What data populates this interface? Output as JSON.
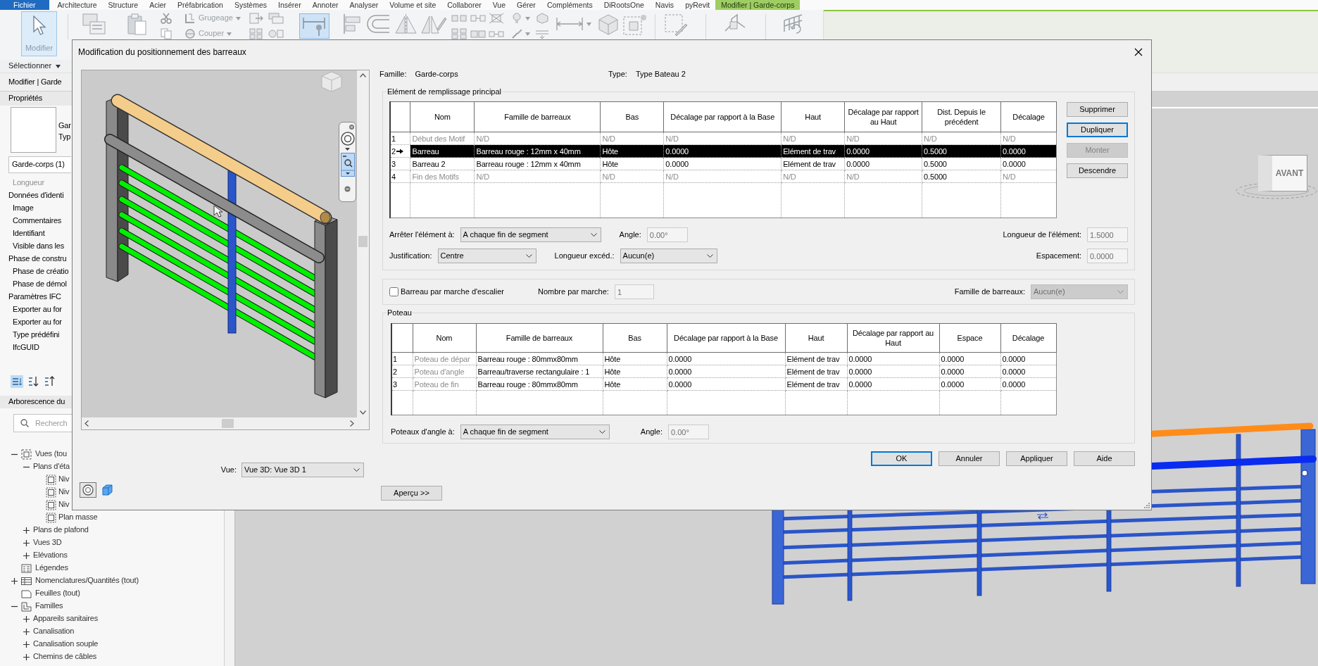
{
  "ribbon_tabs": [
    {
      "label": "Fichier",
      "kind": "file",
      "selected": false
    },
    {
      "label": "Architecture",
      "kind": "standard",
      "selected": false
    },
    {
      "label": "Structure",
      "kind": "standard",
      "selected": false
    },
    {
      "label": "Acier",
      "kind": "standard",
      "selected": false
    },
    {
      "label": "Préfabrication",
      "kind": "standard",
      "selected": false
    },
    {
      "label": "Systèmes",
      "kind": "standard",
      "selected": false
    },
    {
      "label": "Insérer",
      "kind": "standard",
      "selected": false
    },
    {
      "label": "Annoter",
      "kind": "standard",
      "selected": false
    },
    {
      "label": "Analyser",
      "kind": "standard",
      "selected": false
    },
    {
      "label": "Volume et site",
      "kind": "standard",
      "selected": false
    },
    {
      "label": "Collaborer",
      "kind": "standard",
      "selected": false
    },
    {
      "label": "Vue",
      "kind": "standard",
      "selected": false
    },
    {
      "label": "Gérer",
      "kind": "standard",
      "selected": false
    },
    {
      "label": "Compléments",
      "kind": "standard",
      "selected": false
    },
    {
      "label": "DiRootsOne",
      "kind": "standard",
      "selected": false
    },
    {
      "label": "Navis",
      "kind": "standard",
      "selected": false
    },
    {
      "label": "pyRevit",
      "kind": "standard",
      "selected": false
    },
    {
      "label": "Modifier | Garde-corps",
      "kind": "contextual",
      "selected": true
    }
  ],
  "ribbon": {
    "modify_button": {
      "label": "Modifier",
      "selected": true
    },
    "small_tools": [
      {
        "label": "Grugeage"
      },
      {
        "label": "Couper"
      }
    ],
    "select_menu": "Sélectionner"
  },
  "options_bar": {
    "context": "Modifier | Garde"
  },
  "properties": {
    "title": "Propriétés",
    "type_lines": [
      "Gar",
      "Typ"
    ],
    "instance_selector": "Garde-corps (1)",
    "rows": [
      {
        "label": "Longueur",
        "kind": "parameter",
        "disabled": true
      },
      {
        "label": "Données d'identi",
        "kind": "group",
        "disabled": false
      },
      {
        "label": "Image",
        "kind": "parameter",
        "disabled": false
      },
      {
        "label": "Commentaires",
        "kind": "parameter",
        "disabled": false
      },
      {
        "label": "Identifiant",
        "kind": "parameter",
        "disabled": false
      },
      {
        "label": "Visible dans les",
        "kind": "parameter",
        "disabled": false
      },
      {
        "label": "Phase de constru",
        "kind": "group",
        "disabled": false
      },
      {
        "label": "Phase de créatio",
        "kind": "parameter",
        "disabled": false
      },
      {
        "label": "Phase de démol",
        "kind": "parameter",
        "disabled": false
      },
      {
        "label": "Paramètres IFC",
        "kind": "group",
        "disabled": false
      },
      {
        "label": "Exporter au for",
        "kind": "parameter",
        "disabled": false
      },
      {
        "label": "Exporter au for",
        "kind": "parameter",
        "disabled": false
      },
      {
        "label": "Type prédéfini",
        "kind": "parameter",
        "disabled": false
      },
      {
        "label": "IfcGUID",
        "kind": "parameter",
        "disabled": false
      }
    ],
    "sort_buttons": [
      {
        "kind": "categorized",
        "selected": true
      },
      {
        "kind": "ascending",
        "selected": false
      },
      {
        "kind": "descending",
        "selected": false
      }
    ]
  },
  "project_browser": {
    "title": "Arborescence du",
    "search": {
      "placeholder": "Recherch"
    },
    "tree": [
      {
        "label": "Vues (tou",
        "kind": "views",
        "expanded": true,
        "children": [
          {
            "label": "Plans d'éta",
            "expanded": true,
            "children": [
              {
                "label": "Niv",
                "kind": "plan"
              },
              {
                "label": "Niv",
                "kind": "plan"
              },
              {
                "label": "Niv",
                "kind": "plan"
              },
              {
                "label": "Plan masse",
                "kind": "plan"
              }
            ]
          },
          {
            "label": "Plans de plafond",
            "expanded": false
          },
          {
            "label": "Vues 3D",
            "expanded": false
          },
          {
            "label": "Elévations",
            "expanded": false
          }
        ]
      },
      {
        "label": "Légendes",
        "kind": "legend"
      },
      {
        "label": "Nomenclatures/Quantités (tout)",
        "kind": "schedule",
        "expanded": false
      },
      {
        "label": "Feuilles (tout)",
        "kind": "sheet"
      },
      {
        "label": "Familles",
        "kind": "family",
        "expanded": true,
        "children": [
          {
            "label": "Appareils sanitaires",
            "expanded": false
          },
          {
            "label": "Canalisation",
            "expanded": false
          },
          {
            "label": "Canalisation souple",
            "expanded": false
          },
          {
            "label": "Chemins de câbles",
            "expanded": false
          }
        ]
      }
    ]
  },
  "view": {
    "view_cube_label": "AVANT"
  },
  "dialog": {
    "title": "Modification du positionnement des barreaux",
    "preview": {
      "view_label": "Vue:",
      "view_select": "Vue 3D: Vue 3D 1"
    },
    "family": {
      "label": "Famille:",
      "value": "Garde-corps"
    },
    "type": {
      "label": "Type:",
      "value": "Type Bateau 2"
    },
    "main_pattern": {
      "title": "Elément de remplissage principal",
      "columns": [
        "Nom",
        "Famille de barreaux",
        "Bas",
        "Décalage par rapport à la Base",
        "Haut",
        "Décalage par rapport au Haut",
        "Dist. Depuis le précédent",
        "Décalage"
      ],
      "rows": [
        {
          "number": "1",
          "selected": false,
          "cells": [
            {
              "text": "Début des Motif",
              "disabled": true
            },
            {
              "text": "N/D",
              "disabled": true
            },
            {
              "text": "N/D",
              "disabled": true
            },
            {
              "text": "N/D",
              "disabled": true
            },
            {
              "text": "N/D",
              "disabled": true
            },
            {
              "text": "N/D",
              "disabled": true
            },
            {
              "text": "N/D",
              "disabled": true
            },
            {
              "text": "N/D",
              "disabled": true
            }
          ]
        },
        {
          "number": "2",
          "selected": true,
          "cells": [
            {
              "text": "Barreau",
              "disabled": false
            },
            {
              "text": "Barreau rouge : 12mm x 40mm",
              "disabled": false
            },
            {
              "text": "Hôte",
              "disabled": false
            },
            {
              "text": "0.0000",
              "disabled": false
            },
            {
              "text": "Elément de trav",
              "disabled": false
            },
            {
              "text": "0.0000",
              "disabled": false
            },
            {
              "text": "0.5000",
              "disabled": false
            },
            {
              "text": "0.0000",
              "disabled": false
            }
          ]
        },
        {
          "number": "3",
          "selected": false,
          "cells": [
            {
              "text": "Barreau 2",
              "disabled": false
            },
            {
              "text": "Barreau rouge : 12mm x 40mm",
              "disabled": false
            },
            {
              "text": "Hôte",
              "disabled": false
            },
            {
              "text": "0.0000",
              "disabled": false
            },
            {
              "text": "Elément de trav",
              "disabled": false
            },
            {
              "text": "0.0000",
              "disabled": false
            },
            {
              "text": "0.5000",
              "disabled": false
            },
            {
              "text": "0.0000",
              "disabled": false
            }
          ]
        },
        {
          "number": "4",
          "selected": false,
          "cells": [
            {
              "text": "Fin des Motifs",
              "disabled": true
            },
            {
              "text": "N/D",
              "disabled": true
            },
            {
              "text": "N/D",
              "disabled": true
            },
            {
              "text": "N/D",
              "disabled": true
            },
            {
              "text": "N/D",
              "disabled": true
            },
            {
              "text": "N/D",
              "disabled": true
            },
            {
              "text": "0.5000",
              "disabled": false
            },
            {
              "text": "N/D",
              "disabled": true
            }
          ]
        }
      ],
      "buttons": [
        {
          "label": "Supprimer",
          "disabled": false,
          "focused": false
        },
        {
          "label": "Dupliquer",
          "disabled": false,
          "focused": true
        },
        {
          "label": "Monter",
          "disabled": true,
          "focused": false
        },
        {
          "label": "Descendre",
          "disabled": false,
          "focused": false
        }
      ],
      "field_rows": [
        [
          {
            "label": "Arrêter l'élément à:",
            "kind": "select",
            "value": "A chaque fin de segment",
            "disabled": false
          },
          {
            "label": "Angle:",
            "kind": "input",
            "value": "0.00°",
            "disabled": true
          },
          {
            "label": "Longueur de l'élément:",
            "kind": "input",
            "value": "1.5000",
            "disabled": true
          }
        ],
        [
          {
            "label": "Justification:",
            "kind": "select",
            "value": "Centre",
            "disabled": false
          },
          {
            "label": "Longueur excéd.:",
            "kind": "select",
            "value": "Aucun(e)",
            "disabled": false
          },
          {
            "label": "Espacement:",
            "kind": "input",
            "value": "0.0000",
            "disabled": true
          }
        ]
      ]
    },
    "stair": {
      "checkbox": {
        "label": "Barreau par marche d'escalier",
        "checked": false
      },
      "fields": [
        {
          "label": "Nombre par marche:",
          "kind": "input",
          "value": "1",
          "disabled": true
        },
        {
          "label": "Famille de barreaux:",
          "kind": "select",
          "value": "Aucun(e)",
          "disabled": true
        }
      ]
    },
    "posts": {
      "title": "Poteau",
      "columns": [
        "Nom",
        "Famille de barreaux",
        "Bas",
        "Décalage par rapport à la Base",
        "Haut",
        "Décalage par rapport au Haut",
        "Espace",
        "Décalage"
      ],
      "rows": [
        {
          "number": "1",
          "selected": false,
          "cells": [
            {
              "text": "Poteau de dépar",
              "disabled": true
            },
            {
              "text": "Barreau rouge : 80mmx80mm",
              "disabled": false
            },
            {
              "text": "Hôte",
              "disabled": false
            },
            {
              "text": "0.0000",
              "disabled": false
            },
            {
              "text": "Elément de trav",
              "disabled": false
            },
            {
              "text": "0.0000",
              "disabled": false
            },
            {
              "text": "0.0000",
              "disabled": false
            },
            {
              "text": "0.0000",
              "disabled": false
            }
          ]
        },
        {
          "number": "2",
          "selected": false,
          "cells": [
            {
              "text": "Poteau d'angle",
              "disabled": true
            },
            {
              "text": "Barreau/traverse rectangulaire : 1",
              "disabled": false
            },
            {
              "text": "Hôte",
              "disabled": false
            },
            {
              "text": "0.0000",
              "disabled": false
            },
            {
              "text": "Elément de trav",
              "disabled": false
            },
            {
              "text": "0.0000",
              "disabled": false
            },
            {
              "text": "0.0000",
              "disabled": false
            },
            {
              "text": "0.0000",
              "disabled": false
            }
          ]
        },
        {
          "number": "3",
          "selected": false,
          "cells": [
            {
              "text": "Poteau de fin",
              "disabled": true
            },
            {
              "text": "Barreau rouge : 80mmx80mm",
              "disabled": false
            },
            {
              "text": "Hôte",
              "disabled": false
            },
            {
              "text": "0.0000",
              "disabled": false
            },
            {
              "text": "Elément de trav",
              "disabled": false
            },
            {
              "text": "0.0000",
              "disabled": false
            },
            {
              "text": "0.0000",
              "disabled": false
            },
            {
              "text": "0.0000",
              "disabled": false
            }
          ]
        }
      ],
      "fields": [
        {
          "label": "Poteaux d'angle à:",
          "kind": "select",
          "value": "A chaque fin de segment",
          "disabled": false
        },
        {
          "label": "Angle:",
          "kind": "input",
          "value": "0.00°",
          "disabled": true
        }
      ]
    },
    "buttons": [
      {
        "label": "OK",
        "focused": true
      },
      {
        "label": "Annuler",
        "focused": false
      },
      {
        "label": "Appliquer",
        "focused": false
      },
      {
        "label": "Aide",
        "focused": false
      }
    ],
    "preview_toggle": "Aperçu >>"
  }
}
